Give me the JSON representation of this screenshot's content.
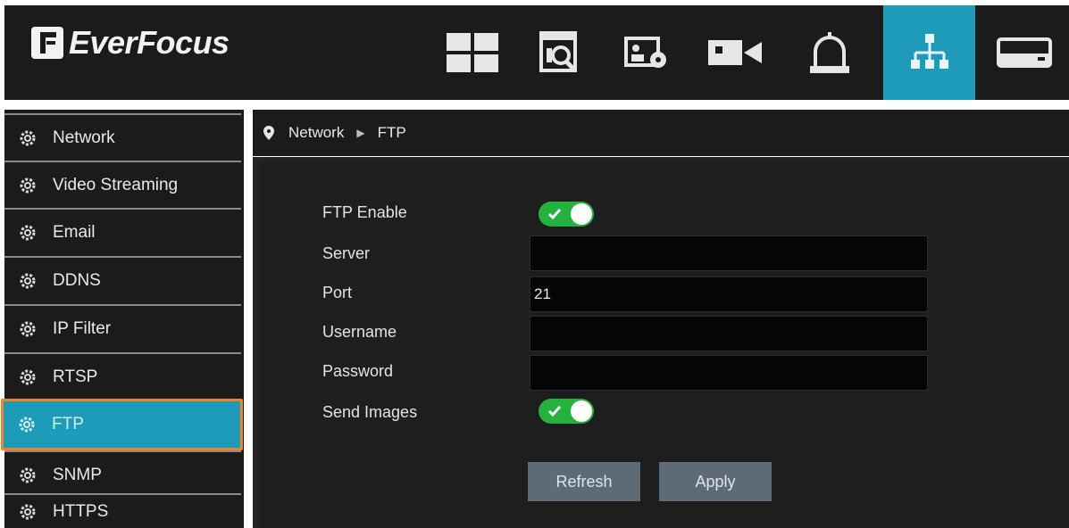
{
  "app": {
    "brand": "EverFocus",
    "colors": {
      "accent": "#1e9bb8",
      "highlight": "#f0842a",
      "toggle_on": "#23b23d",
      "background": "#1b1b1b"
    }
  },
  "top_nav": {
    "items": [
      {
        "icon": "layout-grid-icon",
        "active": false
      },
      {
        "icon": "playback-search-icon",
        "active": false
      },
      {
        "icon": "image-settings-icon",
        "active": false
      },
      {
        "icon": "camera-icon",
        "active": false
      },
      {
        "icon": "alarm-bell-icon",
        "active": false
      },
      {
        "icon": "network-icon",
        "active": true
      },
      {
        "icon": "storage-drive-icon",
        "active": false
      }
    ]
  },
  "sidebar": {
    "items": [
      {
        "label": "Network",
        "icon": "gear-icon",
        "active": false
      },
      {
        "label": "Video Streaming",
        "icon": "gear-icon",
        "active": false
      },
      {
        "label": "Email",
        "icon": "gear-icon",
        "active": false
      },
      {
        "label": "DDNS",
        "icon": "gear-icon",
        "active": false
      },
      {
        "label": "IP Filter",
        "icon": "gear-icon",
        "active": false
      },
      {
        "label": "RTSP",
        "icon": "gear-icon",
        "active": false
      },
      {
        "label": "FTP",
        "icon": "gear-icon",
        "active": true
      },
      {
        "label": "SNMP",
        "icon": "gear-icon",
        "active": false
      },
      {
        "label": "HTTPS",
        "icon": "gear-icon",
        "active": false
      }
    ]
  },
  "breadcrumb": {
    "icon": "location-pin-icon",
    "parent": "Network",
    "current": "FTP"
  },
  "form": {
    "ftp_enable": {
      "label": "FTP Enable",
      "on": true
    },
    "server": {
      "label": "Server",
      "value": ""
    },
    "port": {
      "label": "Port",
      "value": "21"
    },
    "username": {
      "label": "Username",
      "value": ""
    },
    "password": {
      "label": "Password",
      "value": ""
    },
    "send_images": {
      "label": "Send Images",
      "on": true
    }
  },
  "buttons": {
    "refresh": "Refresh",
    "apply": "Apply"
  }
}
